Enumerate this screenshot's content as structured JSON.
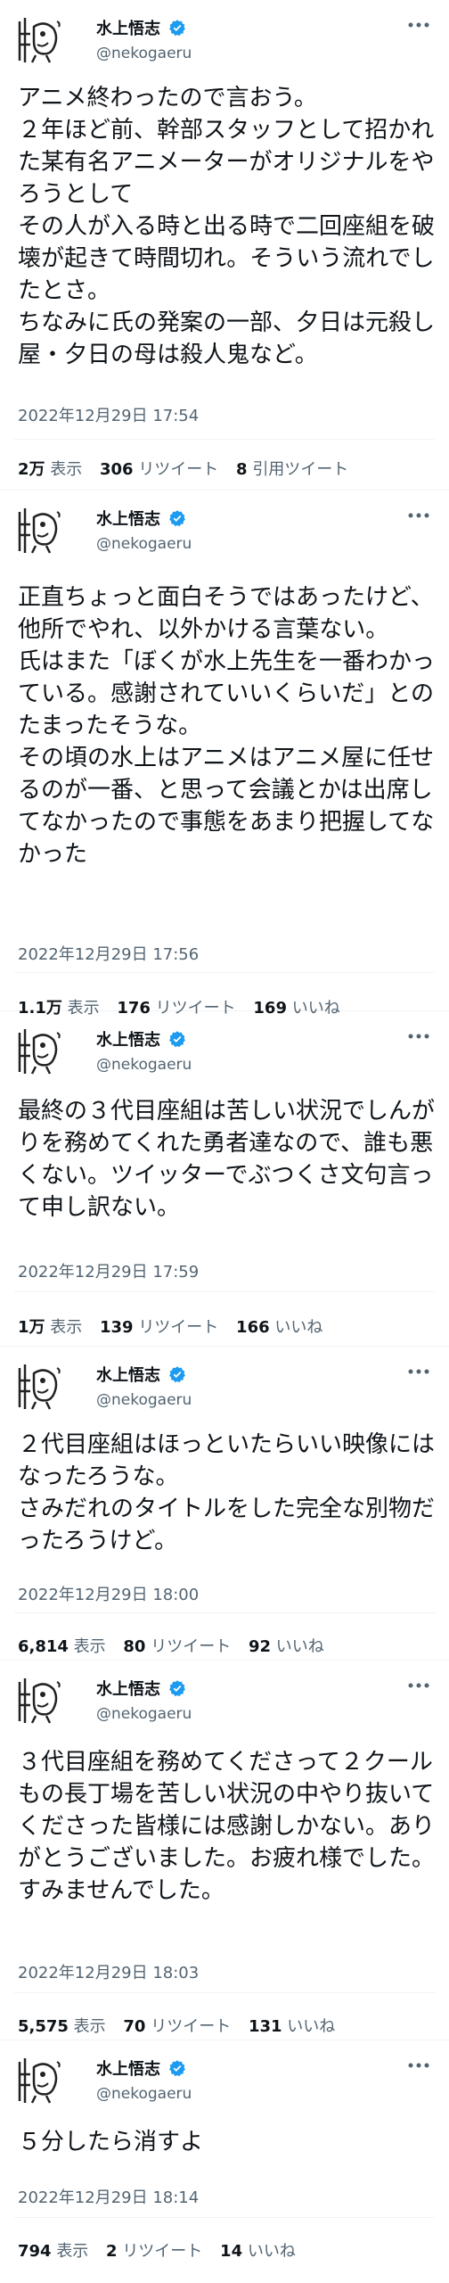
{
  "author": {
    "display_name": "水上悟志",
    "handle": "@nekogaeru",
    "verified_color": "#1d9bf0"
  },
  "tweets": [
    {
      "text": "アニメ終わったので言おう。\n２年ほど前、幹部スタッフとして招かれた某有名アニメーターがオリジナルをやろうとして\nその人が入る時と出る時で二回座組を破壊が起きて時間切れ。そういう流れでしたとさ。\nちなみに氏の発案の一部、夕日は元殺し屋・夕日の母は殺人鬼など。",
      "timestamp": "2022年12月29日 17:54",
      "stats": [
        {
          "value": "2万",
          "label": "表示"
        },
        {
          "value": "306",
          "label": "リツイート"
        },
        {
          "value": "8",
          "label": "引用ツイート"
        }
      ]
    },
    {
      "text": "正直ちょっと面白そうではあったけど、他所でやれ、以外かける言葉ない。\n氏はまた「ぼくが水上先生を一番わかっている。感謝されていいくらいだ」とのたまったそうな。\nその頃の水上はアニメはアニメ屋に任せるのが一番、と思って会議とかは出席してなかったので事態をあまり把握してなかった",
      "timestamp": "2022年12月29日 17:56",
      "stats": [
        {
          "value": "1.1万",
          "label": "表示"
        },
        {
          "value": "176",
          "label": "リツイート"
        },
        {
          "value": "169",
          "label": "いいね"
        }
      ]
    },
    {
      "text": "最終の３代目座組は苦しい状況でしんがりを務めてくれた勇者達なので、誰も悪くない。ツイッターでぶつくさ文句言って申し訳ない。",
      "timestamp": "2022年12月29日 17:59",
      "stats": [
        {
          "value": "1万",
          "label": "表示"
        },
        {
          "value": "139",
          "label": "リツイート"
        },
        {
          "value": "166",
          "label": "いいね"
        }
      ]
    },
    {
      "text": "２代目座組はほっといたらいい映像にはなったろうな。\nさみだれのタイトルをした完全な別物だったろうけど。",
      "timestamp": "2022年12月29日 18:00",
      "stats": [
        {
          "value": "6,814",
          "label": "表示"
        },
        {
          "value": "80",
          "label": "リツイート"
        },
        {
          "value": "92",
          "label": "いいね"
        }
      ]
    },
    {
      "text": "３代目座組を務めてくださって２クールもの長丁場を苦しい状況の中やり抜いてくださった皆様には感謝しかない。ありがとうございました。お疲れ様でした。すみませんでした。",
      "timestamp": "2022年12月29日 18:03",
      "stats": [
        {
          "value": "5,575",
          "label": "表示"
        },
        {
          "value": "70",
          "label": "リツイート"
        },
        {
          "value": "131",
          "label": "いいね"
        }
      ]
    },
    {
      "text": "５分したら消すよ",
      "timestamp": "2022年12月29日 18:14",
      "stats": [
        {
          "value": "794",
          "label": "表示"
        },
        {
          "value": "2",
          "label": "リツイート"
        },
        {
          "value": "14",
          "label": "いいね"
        }
      ]
    }
  ]
}
